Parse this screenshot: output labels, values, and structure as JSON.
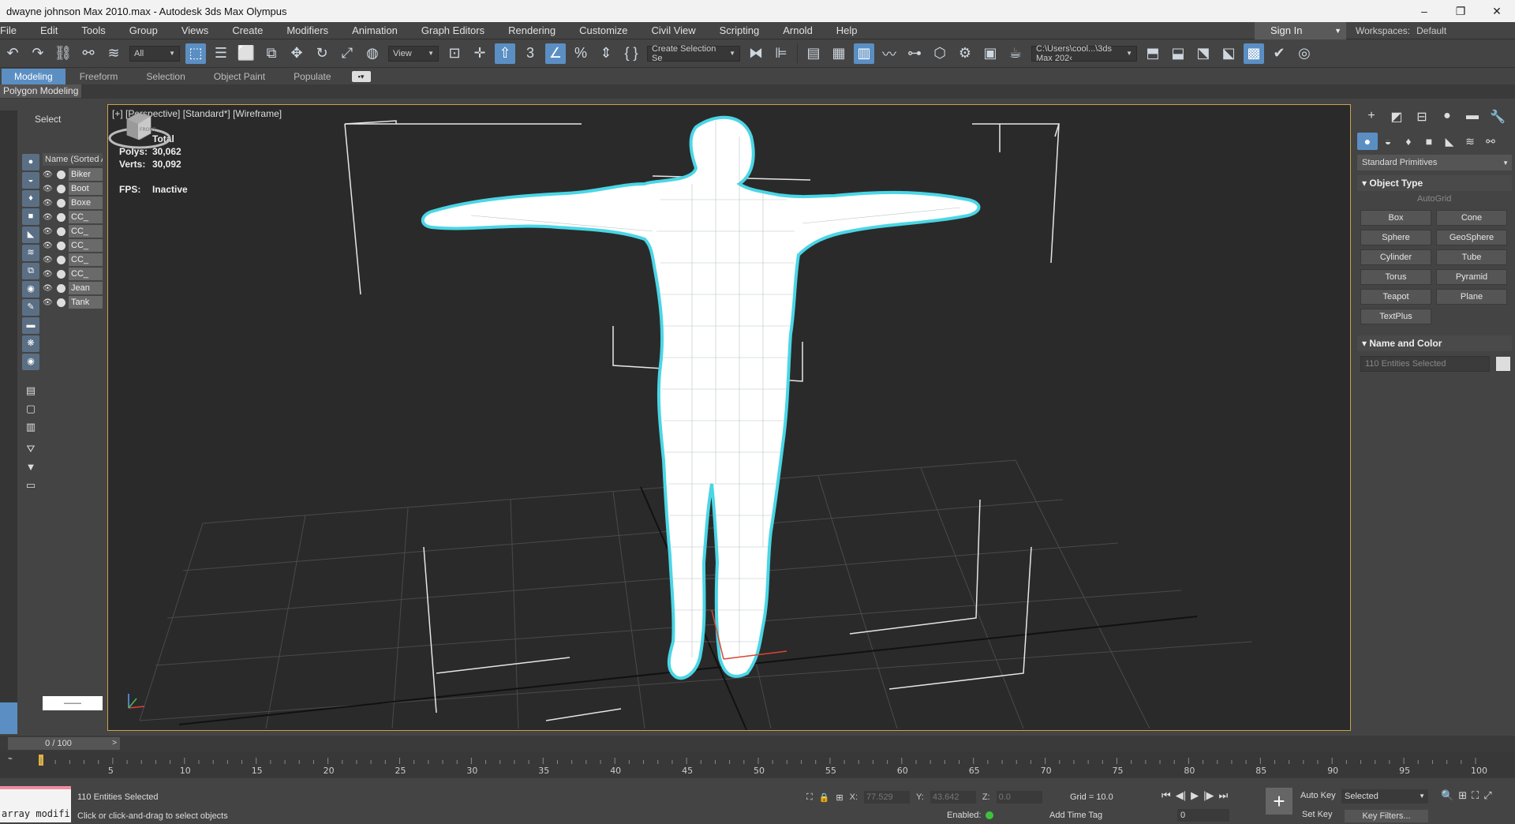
{
  "window": {
    "title": "dwayne johnson Max 2010.max - Autodesk 3ds Max Olympus",
    "minimize": "–",
    "maximize": "❐",
    "close": "✕"
  },
  "menubar": {
    "items": [
      "File",
      "Edit",
      "Tools",
      "Group",
      "Views",
      "Create",
      "Modifiers",
      "Animation",
      "Graph Editors",
      "Rendering",
      "Customize",
      "Civil View",
      "Scripting",
      "Arnold",
      "Help"
    ],
    "sign_in": "Sign In",
    "workspaces_label": "Workspaces:",
    "workspaces_value": "Default"
  },
  "toolbar": {
    "filter_value": "All",
    "view_value": "View",
    "selection_set": "Create Selection Se",
    "project_path": "C:\\Users\\cool...\\3ds Max 202‹"
  },
  "ribbon": {
    "tabs": [
      "Modeling",
      "Freeform",
      "Selection",
      "Object Paint",
      "Populate"
    ],
    "sub": "Polygon Modeling"
  },
  "explorer": {
    "select_label": "Select",
    "column_header": "Name (Sorted A",
    "rows": [
      "Biker",
      "Boot",
      "Boxe",
      "CC_",
      "CC_",
      "CC_",
      "CC_",
      "CC_",
      "Jean",
      "Tank"
    ]
  },
  "viewport": {
    "label": "[+] [Perspective] [Standard*] [Wireframe]",
    "stats_total": "Total",
    "polys_label": "Polys:",
    "polys_value": "30,062",
    "verts_label": "Verts:",
    "verts_value": "30,092",
    "fps_label": "FPS:",
    "fps_value": "Inactive",
    "viewcube_label": "FRONT"
  },
  "command_panel": {
    "category": "Standard Primitives",
    "object_type_title": "Object Type",
    "autogrid": "AutoGrid",
    "buttons": [
      "Box",
      "Cone",
      "Sphere",
      "GeoSphere",
      "Cylinder",
      "Tube",
      "Torus",
      "Pyramid",
      "Teapot",
      "Plane",
      "TextPlus"
    ],
    "name_color_title": "Name and Color",
    "entities_field": "110 Entities Selected"
  },
  "timeline": {
    "slider": "0 / 100",
    "ticks": [
      "5",
      "10",
      "15",
      "20",
      "25",
      "30",
      "35",
      "40",
      "45",
      "50",
      "55",
      "60",
      "65",
      "70",
      "75",
      "80",
      "85",
      "90",
      "95",
      "100"
    ]
  },
  "statusbar": {
    "maxscript": "array modifi",
    "selected_msg": "110 Entities Selected",
    "prompt_msg": "Click or click-and-drag to select objects",
    "x_label": "X:",
    "x_value": "77.529",
    "y_label": "Y:",
    "y_value": "43.642",
    "z_label": "Z:",
    "z_value": "0.0",
    "grid": "Grid = 10.0",
    "enabled": "Enabled:",
    "add_time_tag": "Add Time Tag",
    "auto_key": "Auto Key",
    "set_key": "Set Key",
    "selected_dd": "Selected",
    "key_filters": "Key Filters...",
    "frame_value": "0"
  }
}
